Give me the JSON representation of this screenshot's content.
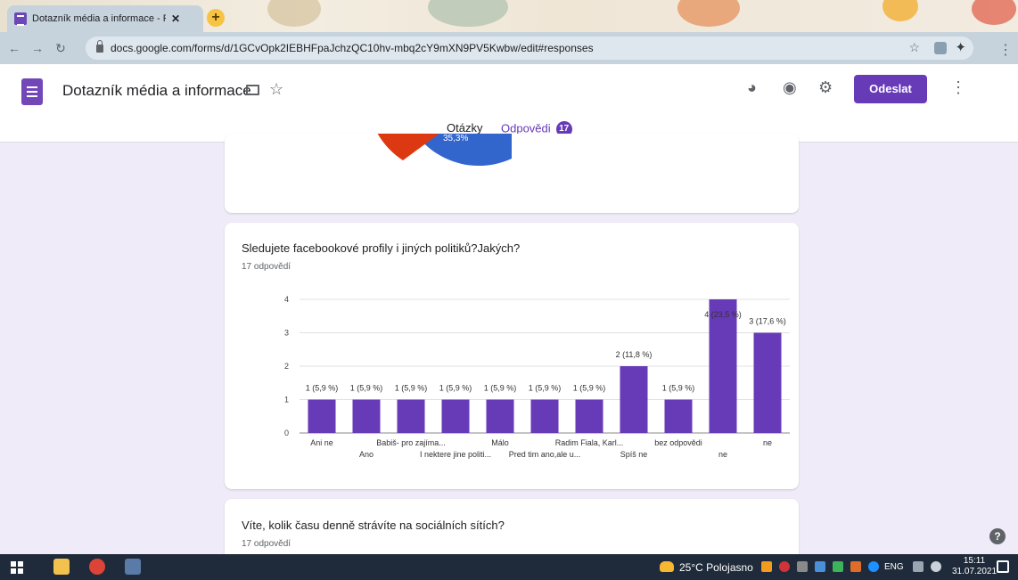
{
  "browser": {
    "tab_title": "Dotazník média a informace - Fo",
    "tab_close": "✕",
    "new_tab": "+",
    "url": "docs.google.com/forms/d/1GCvOpk2IEBHFpaJchzQC10hv-mbq2cY9mXN9PV5Kwbw/edit#responses"
  },
  "form": {
    "title": "Dotazník média a informace",
    "send_label": "Odeslat",
    "tabs": [
      {
        "label": "Otázky"
      },
      {
        "label": "Odpovědi",
        "badge": "17"
      }
    ],
    "accent": "#673ab7"
  },
  "cards": {
    "previous_pie": {
      "slice_label": "35,3%",
      "colors": [
        "#3366cc",
        "#dc3912"
      ]
    },
    "question2": {
      "title": "Sledujete facebookové profily i jiných politiků?Jakých?",
      "responses": "17 odpovědí"
    },
    "question3": {
      "title": "Víte, kolik času denně strávíte na sociálních sítích?",
      "responses": "17 odpovědí"
    }
  },
  "chart_data": {
    "type": "bar",
    "categories": [
      "Ani ne",
      "Ano",
      "Babiš- pro zajíma...",
      "I nektere jine politi...",
      "Málo",
      "Pred tim ano,ale u...",
      "Radim Fiala, Karl...",
      "Spíš ne",
      "bez odpovědi",
      "ne",
      "ne"
    ],
    "values": [
      1,
      1,
      1,
      1,
      1,
      1,
      1,
      2,
      1,
      4,
      3
    ],
    "data_labels": [
      "1 (5,9 %)",
      "1 (5,9 %)",
      "1 (5,9 %)",
      "1 (5,9 %)",
      "1 (5,9 %)",
      "1 (5,9 %)",
      "1 (5,9 %)",
      "2 (11,8 %)",
      "1 (5,9 %)",
      "4 (23,5 %)",
      "3 (17,6 %)"
    ],
    "y_ticks": [
      "0",
      "1",
      "2",
      "3",
      "4"
    ],
    "ylim": [
      0,
      4
    ],
    "bar_color": "#673ab7",
    "grid": true
  },
  "taskbar": {
    "weather": "25°C Polojasno",
    "lang": "ENG",
    "time": "15:11",
    "date": "31.07.2021"
  },
  "help": "?"
}
